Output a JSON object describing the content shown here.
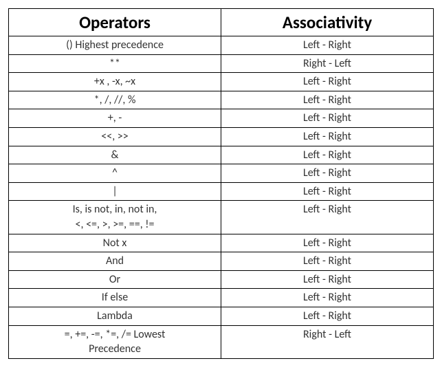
{
  "headers": {
    "operators": "Operators",
    "associativity": "Associativity"
  },
  "rows": [
    {
      "op": "()  Highest precedence",
      "assoc": "Left - Right"
    },
    {
      "op": "**",
      "assoc": "Right - Left"
    },
    {
      "op": "+x , -x, ~x",
      "assoc": "Left - Right"
    },
    {
      "op": "*, /, //, %",
      "assoc": "Left - Right"
    },
    {
      "op": "+, -",
      "assoc": "Left - Right"
    },
    {
      "op": "<<, >>",
      "assoc": "Left - Right"
    },
    {
      "op": "&",
      "assoc": "Left - Right"
    },
    {
      "op": "^",
      "assoc": "Left - Right"
    },
    {
      "op": "|",
      "assoc": "Left - Right"
    },
    {
      "op": "Is, is not, in, not in,\n<, <=, >, >=, ==, !=",
      "assoc": "Left - Right"
    },
    {
      "op": "Not x",
      "assoc": "Left - Right"
    },
    {
      "op": "And",
      "assoc": "Left - Right"
    },
    {
      "op": "Or",
      "assoc": "Left - Right"
    },
    {
      "op": "If else",
      "assoc": "Left - Right"
    },
    {
      "op": "Lambda",
      "assoc": "Left - Right"
    },
    {
      "op": "=, +=, -=, *=, /=  Lowest\nPrecedence",
      "assoc": "Right - Left"
    }
  ],
  "chart_data": {
    "type": "table",
    "title": "Python Operator Precedence and Associativity",
    "columns": [
      "Operators",
      "Associativity"
    ],
    "rows": [
      [
        "()  Highest precedence",
        "Left - Right"
      ],
      [
        "**",
        "Right - Left"
      ],
      [
        "+x , -x, ~x",
        "Left - Right"
      ],
      [
        "*, /, //, %",
        "Left - Right"
      ],
      [
        "+, -",
        "Left - Right"
      ],
      [
        "<<, >>",
        "Left - Right"
      ],
      [
        "&",
        "Left - Right"
      ],
      [
        "^",
        "Left - Right"
      ],
      [
        "|",
        "Left - Right"
      ],
      [
        "Is, is not, in, not in, <, <=, >, >=, ==, !=",
        "Left - Right"
      ],
      [
        "Not x",
        "Left - Right"
      ],
      [
        "And",
        "Left - Right"
      ],
      [
        "Or",
        "Left - Right"
      ],
      [
        "If else",
        "Left - Right"
      ],
      [
        "Lambda",
        "Left - Right"
      ],
      [
        "=, +=, -=, *=, /=  Lowest Precedence",
        "Right - Left"
      ]
    ]
  }
}
